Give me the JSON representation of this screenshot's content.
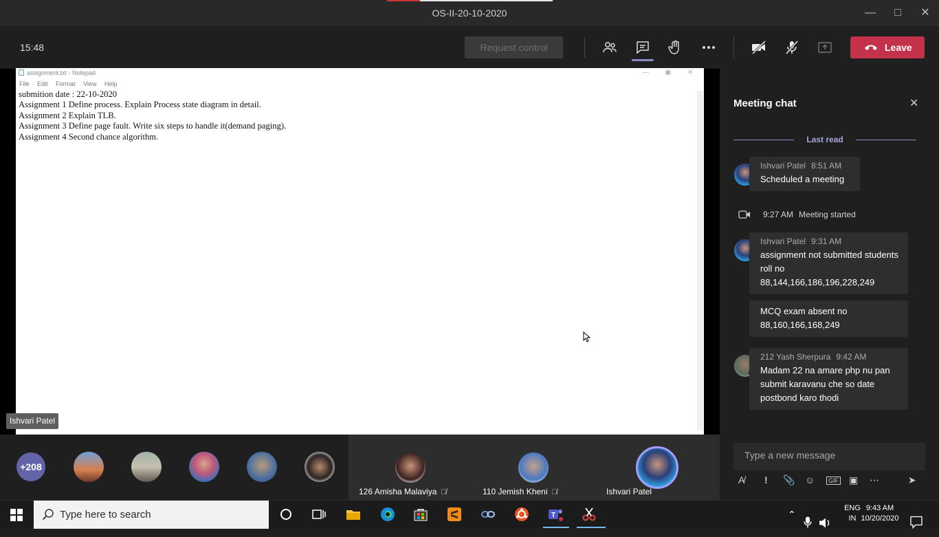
{
  "window": {
    "title": "OS-II-20-10-2020"
  },
  "toolbar": {
    "timer": "15:48",
    "request_control": "Request control",
    "leave": "Leave"
  },
  "notepad": {
    "title": "assignment.txt - Notepad",
    "menu": [
      "File",
      "Edit",
      "Format",
      "View",
      "Help"
    ],
    "lines": [
      "submition date : 22-10-2020",
      "Assignment 1 Define process. Explain Process state diagram in detail.",
      "Assignment 2 Explain TLB.",
      "Assignment 3 Define page fault. Write six steps to handle it(demand paging).",
      "Assignment 4 Second chance algorithm."
    ]
  },
  "presenter": {
    "name": "Ishvari Patel"
  },
  "participants": {
    "overflow": "+208",
    "tiles": [
      {
        "name": "126 Amisha Malaviya"
      },
      {
        "name": "110 Jemish Kheni"
      },
      {
        "name": "Ishvari Patel"
      }
    ]
  },
  "chat": {
    "title": "Meeting chat",
    "last_read": "Last read",
    "messages": [
      {
        "author": "Ishvari Patel",
        "time": "8:51 AM",
        "text": "Scheduled a meeting"
      },
      {
        "author": "Ishvari Patel",
        "time": "9:31 AM",
        "text": "assignment not submitted students roll no 88,144,166,186,196,228,249"
      },
      {
        "text": "MCQ exam absent no 88,160,166,168,249"
      },
      {
        "author": "212 Yash Sherpura",
        "time": "9:42 AM",
        "text": "Madam 22 na amare php nu pan submit karavanu che so date postbond karo thodi"
      }
    ],
    "system": {
      "time": "9:27 AM",
      "text": "Meeting started"
    },
    "compose_placeholder": "Type a new message"
  },
  "taskbar": {
    "search_placeholder": "Type here to search",
    "lang": "ENG",
    "region": "IN",
    "time": "9:43 AM",
    "date": "10/20/2020"
  },
  "colors": {
    "teams_purple": "#6264a7",
    "leave_red": "#c4314b",
    "chat_bg": "#1f1f1f"
  }
}
